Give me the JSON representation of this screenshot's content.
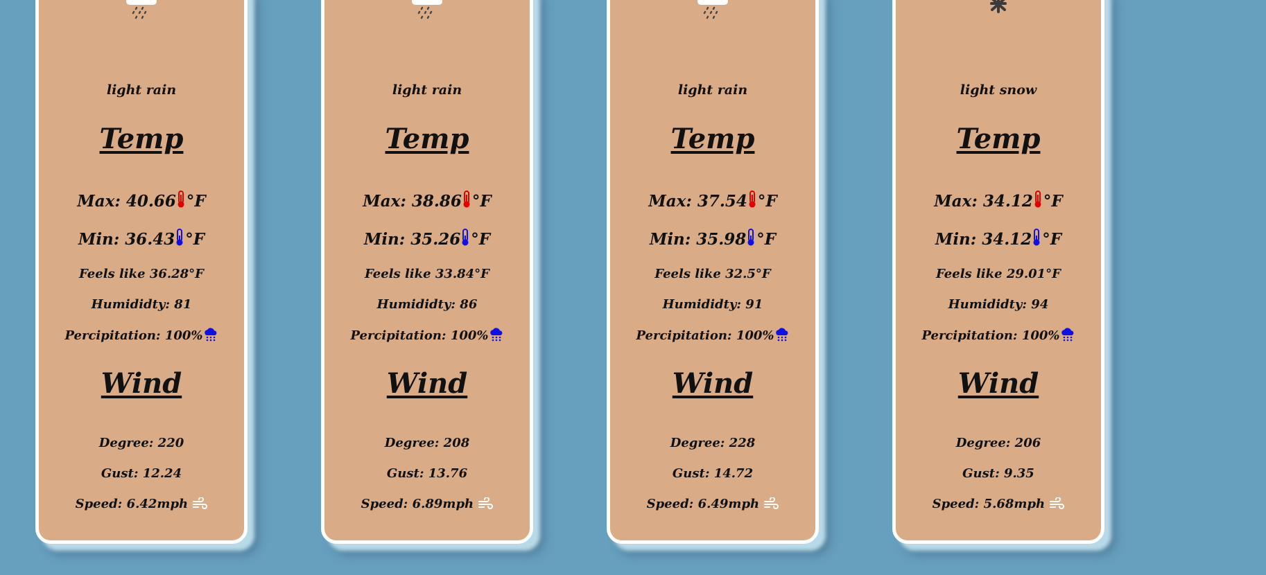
{
  "cards": [
    {
      "icon": "rain-cloud-icon",
      "description": "light rain",
      "temp_heading": "Temp",
      "max_label": "Max: 40.66",
      "min_label": "Min: 36.43",
      "unit": "°F",
      "feels_like": "Feels like 36.28°F",
      "humidity": "Humididty: 81",
      "precipitation": "Percipitation: 100%",
      "wind_heading": "Wind",
      "degree": "Degree: 220",
      "gust": "Gust: 12.24",
      "speed": "Speed: 6.42mph"
    },
    {
      "icon": "rain-cloud-icon",
      "description": "light rain",
      "temp_heading": "Temp",
      "max_label": "Max: 38.86",
      "min_label": "Min: 35.26",
      "unit": "°F",
      "feels_like": "Feels like 33.84°F",
      "humidity": "Humididty: 86",
      "precipitation": "Percipitation: 100%",
      "wind_heading": "Wind",
      "degree": "Degree: 208",
      "gust": "Gust: 13.76",
      "speed": "Speed: 6.89mph"
    },
    {
      "icon": "rain-cloud-icon",
      "description": "light rain",
      "temp_heading": "Temp",
      "max_label": "Max: 37.54",
      "min_label": "Min: 35.98",
      "unit": "°F",
      "feels_like": "Feels like 32.5°F",
      "humidity": "Humididty: 91",
      "precipitation": "Percipitation: 100%",
      "wind_heading": "Wind",
      "degree": "Degree: 228",
      "gust": "Gust: 14.72",
      "speed": "Speed: 6.49mph"
    },
    {
      "icon": "snowflake-icon",
      "description": "light snow",
      "temp_heading": "Temp",
      "max_label": "Max: 34.12",
      "min_label": "Min: 34.12",
      "unit": "°F",
      "feels_like": "Feels like 29.01°F",
      "humidity": "Humididty: 94",
      "precipitation": "Percipitation: 100%",
      "wind_heading": "Wind",
      "degree": "Degree: 206",
      "gust": "Gust: 9.35",
      "speed": "Speed: 5.68mph"
    }
  ],
  "colors": {
    "background": "#679fbf",
    "card": "#daab87",
    "hot": "#e00000",
    "cold": "#1010e0",
    "wind_icon": "#ffffff"
  }
}
